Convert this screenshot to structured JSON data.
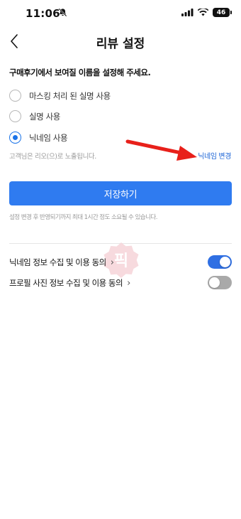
{
  "status_bar": {
    "time": "11:06",
    "battery": "46",
    "icons": [
      "bell-slash-icon",
      "signal-icon",
      "wifi-icon",
      "battery-icon"
    ]
  },
  "header": {
    "title": "리뷰 설정",
    "back_icon": "chevron-left-icon"
  },
  "name_settings": {
    "instruction": "구매후기에서 보여질 이름을 설정해 주세요.",
    "options": [
      {
        "label": "마스킹 처리 된 실명 사용",
        "selected": false
      },
      {
        "label": "실명 사용",
        "selected": false
      },
      {
        "label": "닉네임 사용",
        "selected": true
      }
    ],
    "hint": "고객님은 리오(으)로 노출됩니다.",
    "change_link": "닉네임 변경"
  },
  "save_button": {
    "label": "저장하기"
  },
  "notice": "설정 변경 후 반영되기까지 최대 1시간 정도 소요될 수 있습니다.",
  "consents": [
    {
      "label": "닉네임 정보 수집 및 이용 동의",
      "chevron": "›",
      "enabled": true
    },
    {
      "label": "프로필 사진 정보 수집 및 이용 동의",
      "chevron": "›",
      "enabled": false
    }
  ],
  "watermark": {
    "text": "픽"
  },
  "colors": {
    "accent": "#2f7bf0",
    "link": "#1a63d6",
    "toggle_on": "#2f6fe3",
    "toggle_off": "#a9a9a9",
    "annotation_arrow": "#e8201a",
    "watermark": "#f4c9cf"
  }
}
